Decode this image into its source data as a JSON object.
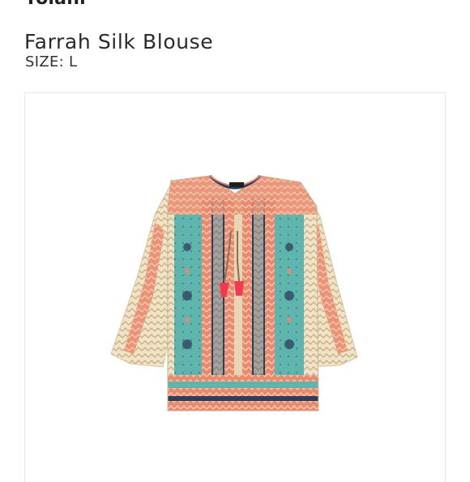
{
  "product": {
    "brand": "Yolani",
    "name": "Farrah Silk Blouse",
    "size_label": "SIZE:",
    "size_value": "L",
    "image_alt": "Farrah Silk Blouse product photo"
  },
  "palette": {
    "teal": "#5fb5ae",
    "coral": "#e9826c",
    "beige": "#e8d6b3",
    "navy": "#2f3d5c",
    "tassel": "#f03a4e"
  }
}
